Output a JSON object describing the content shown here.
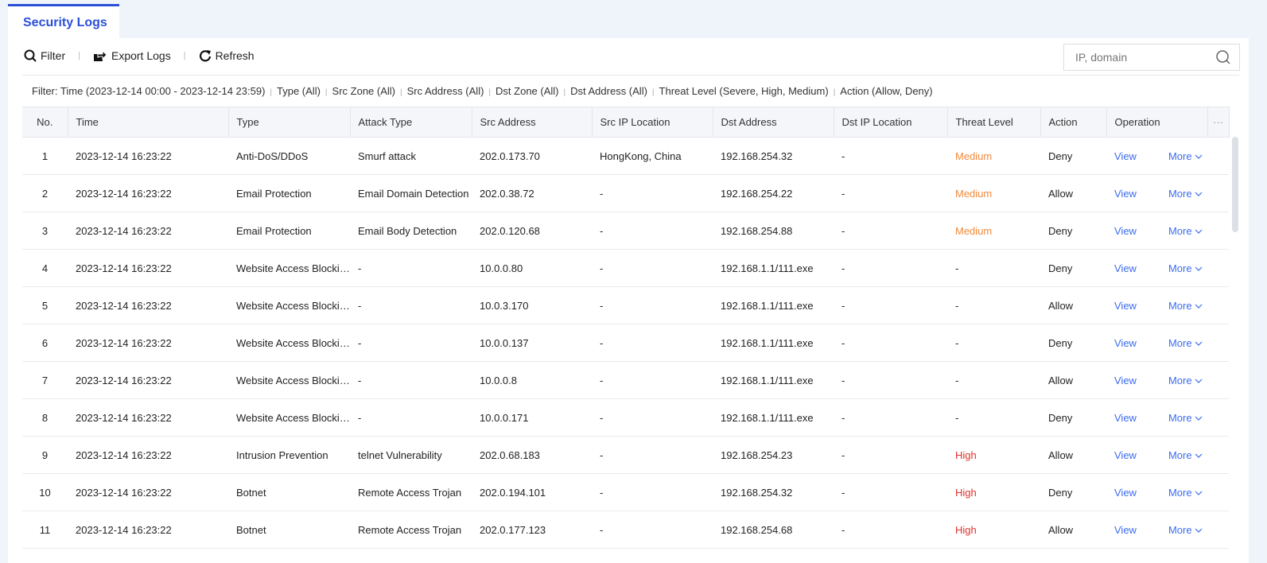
{
  "tab": "Security Logs",
  "toolbar": {
    "filter": "Filter",
    "export": "Export Logs",
    "refresh": "Refresh"
  },
  "search": {
    "placeholder": "IP, domain"
  },
  "filter_summary": {
    "prefix": "Filter:",
    "items": [
      "Time (2023-12-14 00:00 - 2023-12-14 23:59)",
      "Type (All)",
      "Src Zone (All)",
      "Src Address (All)",
      "Dst Zone (All)",
      "Dst Address (All)",
      "Threat Level (Severe, High, Medium)",
      "Action (Allow, Deny)"
    ]
  },
  "columns": [
    "No.",
    "Time",
    "Type",
    "Attack Type",
    "Src Address",
    "Src IP Location",
    "Dst Address",
    "Dst IP Location",
    "Threat Level",
    "Action",
    "Operation",
    "···"
  ],
  "ops": {
    "view": "View",
    "more": "More"
  },
  "colors": {
    "accent": "#2b50d8",
    "medium": "#f08a3c",
    "high": "#e0302b",
    "link": "#3b6cf0"
  },
  "rows": [
    {
      "no": "1",
      "time": "2023-12-14 16:23:22",
      "type": "Anti-DoS/DDoS",
      "attack": "Smurf attack",
      "src": "202.0.173.70",
      "srcloc": "HongKong, China",
      "dst": "192.168.254.32",
      "dstloc": "-",
      "threat": "Medium",
      "action": "Deny"
    },
    {
      "no": "2",
      "time": "2023-12-14 16:23:22",
      "type": "Email Protection",
      "attack": "Email Domain Detection",
      "src": "202.0.38.72",
      "srcloc": "-",
      "dst": "192.168.254.22",
      "dstloc": "-",
      "threat": "Medium",
      "action": "Allow"
    },
    {
      "no": "3",
      "time": "2023-12-14 16:23:22",
      "type": "Email Protection",
      "attack": "Email Body Detection",
      "src": "202.0.120.68",
      "srcloc": "-",
      "dst": "192.168.254.88",
      "dstloc": "-",
      "threat": "Medium",
      "action": "Deny"
    },
    {
      "no": "4",
      "time": "2023-12-14 16:23:22",
      "type": "Website Access Blocking",
      "attack": "-",
      "src": "10.0.0.80",
      "srcloc": "-",
      "dst": "192.168.1.1/111.exe",
      "dstloc": "-",
      "threat": "-",
      "action": "Deny"
    },
    {
      "no": "5",
      "time": "2023-12-14 16:23:22",
      "type": "Website Access Blocking",
      "attack": "-",
      "src": "10.0.3.170",
      "srcloc": "-",
      "dst": "192.168.1.1/111.exe",
      "dstloc": "-",
      "threat": "-",
      "action": "Allow"
    },
    {
      "no": "6",
      "time": "2023-12-14 16:23:22",
      "type": "Website Access Blocking",
      "attack": "-",
      "src": "10.0.0.137",
      "srcloc": "-",
      "dst": "192.168.1.1/111.exe",
      "dstloc": "-",
      "threat": "-",
      "action": "Deny"
    },
    {
      "no": "7",
      "time": "2023-12-14 16:23:22",
      "type": "Website Access Blocking",
      "attack": "-",
      "src": "10.0.0.8",
      "srcloc": "-",
      "dst": "192.168.1.1/111.exe",
      "dstloc": "-",
      "threat": "-",
      "action": "Allow"
    },
    {
      "no": "8",
      "time": "2023-12-14 16:23:22",
      "type": "Website Access Blocking",
      "attack": "-",
      "src": "10.0.0.171",
      "srcloc": "-",
      "dst": "192.168.1.1/111.exe",
      "dstloc": "-",
      "threat": "-",
      "action": "Deny"
    },
    {
      "no": "9",
      "time": "2023-12-14 16:23:22",
      "type": "Intrusion Prevention",
      "attack": "telnet Vulnerability",
      "src": "202.0.68.183",
      "srcloc": "-",
      "dst": "192.168.254.23",
      "dstloc": "-",
      "threat": "High",
      "action": "Allow"
    },
    {
      "no": "10",
      "time": "2023-12-14 16:23:22",
      "type": "Botnet",
      "attack": "Remote Access Trojan",
      "src": "202.0.194.101",
      "srcloc": "-",
      "dst": "192.168.254.32",
      "dstloc": "-",
      "threat": "High",
      "action": "Deny"
    },
    {
      "no": "11",
      "time": "2023-12-14 16:23:22",
      "type": "Botnet",
      "attack": "Remote Access Trojan",
      "src": "202.0.177.123",
      "srcloc": "-",
      "dst": "192.168.254.68",
      "dstloc": "-",
      "threat": "High",
      "action": "Allow"
    }
  ]
}
